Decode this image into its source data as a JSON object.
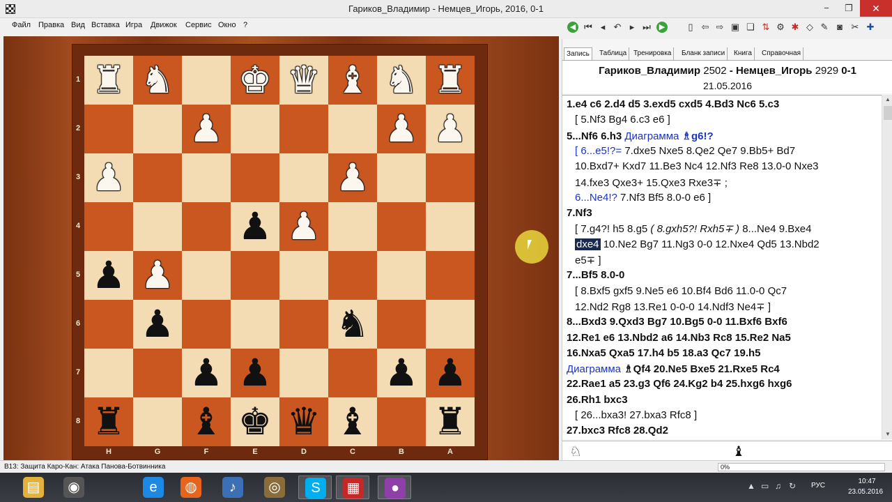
{
  "window": {
    "title": "Гариков_Владимир - Немцев_Игорь,  2016, 0-1",
    "min_glyph": "−",
    "max_glyph": "❐",
    "close_glyph": "✕"
  },
  "menu": [
    "Файл",
    "Правка",
    "Вид",
    "Вставка",
    "Игра",
    "Движок",
    "Сервис",
    "Окно",
    "?"
  ],
  "toolbar_icons": [
    "green-back-icon",
    "first-move-icon",
    "prev-move-icon",
    "undo-icon",
    "next-move-icon",
    "last-move-icon",
    "green-forward-icon",
    "new-doc-icon",
    "arrow-left-icon",
    "arrow-right-icon",
    "save-icon",
    "copy-icon",
    "flip-icon",
    "settings-icon",
    "engine-icon",
    "eraser-icon",
    "pen-icon",
    "camera-icon",
    "tools-icon",
    "plus-icon"
  ],
  "tabs": [
    "Запись",
    "Таблица",
    "Тренировка",
    "Бланк записи",
    "Книга",
    "Справочная"
  ],
  "header": {
    "white": "Гариков_Владимир",
    "white_elo": "2502",
    "black": "Немцев_Игорь",
    "black_elo": "2929",
    "result": "0-1",
    "date": "21.05.2016"
  },
  "board": {
    "pieces": [
      [
        "♜",
        "♞",
        "",
        "♚",
        "♛",
        "♝",
        "♞",
        "♜"
      ],
      [
        "",
        "",
        "♟",
        "",
        "",
        "",
        "♟",
        "♟"
      ],
      [
        "♟",
        "",
        "",
        "",
        "",
        "♟",
        "",
        ""
      ],
      [
        "",
        "",
        "",
        "♟",
        "♟",
        "",
        "",
        ""
      ],
      [
        "♟",
        "♟",
        "",
        "",
        "",
        "",
        "",
        ""
      ],
      [
        "",
        "♟",
        "",
        "",
        "",
        "♞",
        "",
        ""
      ],
      [
        "",
        "",
        "♟",
        "♟",
        "",
        "",
        "♟",
        "♟"
      ],
      [
        "♜",
        "",
        "♝",
        "♚",
        "♛",
        "♝",
        "",
        "♜"
      ]
    ],
    "colors": [
      [
        "w",
        "w",
        "",
        "w",
        "w",
        "w",
        "w",
        "w"
      ],
      [
        "",
        "",
        "w",
        "",
        "",
        "",
        "w",
        "w"
      ],
      [
        "w",
        "",
        "",
        "",
        "",
        "w",
        "",
        ""
      ],
      [
        "",
        "",
        "",
        "b",
        "w",
        "",
        "",
        ""
      ],
      [
        "b",
        "w",
        "",
        "",
        "",
        "",
        "",
        ""
      ],
      [
        "",
        "b",
        "",
        "",
        "",
        "b",
        "",
        ""
      ],
      [
        "",
        "",
        "b",
        "b",
        "",
        "",
        "b",
        "b"
      ],
      [
        "b",
        "",
        "b",
        "b",
        "b",
        "b",
        "",
        "b"
      ]
    ],
    "ranks": [
      "1",
      "2",
      "3",
      "4",
      "5",
      "6",
      "7",
      "8"
    ],
    "files": [
      "H",
      "G",
      "F",
      "E",
      "D",
      "C",
      "B",
      "A"
    ]
  },
  "notation": [
    {
      "type": "main",
      "segments": [
        {
          "t": "1.e4  c6  2.d4  d5  3.exd5  cxd5  4.Bd3  Nc6  5.c3"
        }
      ]
    },
    {
      "type": "var",
      "segments": [
        {
          "t": "[ 5.Nf3  Bg4  6.c3  e6 ]"
        }
      ]
    },
    {
      "type": "main",
      "segments": [
        {
          "t": "5...Nf6  6.h3 "
        },
        {
          "t": "Диаграмма ",
          "c": "blue",
          "w": "normal"
        },
        {
          "t": "♗g6!?",
          "c": "blue"
        }
      ]
    },
    {
      "type": "var",
      "segments": [
        {
          "t": "[ 6...e5!?= ",
          "c": "blue"
        },
        {
          "t": " 7.dxe5  Nxe5  8.Qe2  Qe7  9.Bb5+  Bd7"
        }
      ]
    },
    {
      "type": "var",
      "segments": [
        {
          "t": "10.Bxd7+  Kxd7  11.Be3  Nc4  12.Nf3  Re8  13.0-0  Nxe3"
        }
      ]
    },
    {
      "type": "var",
      "segments": [
        {
          "t": "14.fxe3  Qxe3+  15.Qxe3  Rxe3∓ ;"
        }
      ]
    },
    {
      "type": "var",
      "segments": [
        {
          "t": "6...Ne4!? ",
          "c": "blue"
        },
        {
          "t": " 7.Nf3  Bf5  8.0-0  e6 ]"
        }
      ]
    },
    {
      "type": "main",
      "segments": [
        {
          "t": "7.Nf3"
        }
      ]
    },
    {
      "type": "var",
      "segments": [
        {
          "t": "[ 7.g4?!  h5  8.g5  "
        },
        {
          "t": "( 8.gxh5?!  Rxh5∓ )",
          "i": true
        },
        {
          "t": "  8...Ne4  9.Bxe4"
        }
      ]
    },
    {
      "type": "var",
      "segments": [
        {
          "t": "dxe4",
          "hl": true
        },
        {
          "t": "  10.Ne2  Bg7  11.Ng3  0-0  12.Nxe4  Qd5  13.Nbd2"
        }
      ]
    },
    {
      "type": "var",
      "segments": [
        {
          "t": "e5∓ ]"
        }
      ]
    },
    {
      "type": "main",
      "segments": [
        {
          "t": "7...Bf5  8.0-0"
        }
      ]
    },
    {
      "type": "var",
      "segments": [
        {
          "t": "[ 8.Bxf5  gxf5  9.Ne5  e6  10.Bf4  Bd6  11.0-0  Qc7"
        }
      ]
    },
    {
      "type": "var",
      "segments": [
        {
          "t": "12.Nd2  Rg8  13.Re1  0-0-0  14.Ndf3  Ne4∓ ]"
        }
      ]
    },
    {
      "type": "main",
      "segments": [
        {
          "t": "8...Bxd3  9.Qxd3  Bg7  10.Bg5  0-0  11.Bxf6  Bxf6"
        }
      ]
    },
    {
      "type": "main",
      "segments": [
        {
          "t": "12.Re1  e6  13.Nbd2  a6  14.Nb3  Rc8  15.Re2  Na5"
        }
      ]
    },
    {
      "type": "main",
      "segments": [
        {
          "t": "16.Nxa5  Qxa5  17.h4  b5  18.a3  Qc7  19.h5"
        }
      ]
    },
    {
      "type": "main",
      "segments": [
        {
          "t": "Диаграмма ",
          "c": "blue",
          "w": "normal"
        },
        {
          "t": "♗Qf4  20.Ne5  Bxe5  21.Rxe5  Rc4"
        }
      ]
    },
    {
      "type": "main",
      "segments": [
        {
          "t": "22.Rae1  a5  23.g3  Qf6  24.Kg2  b4  25.hxg6  hxg6"
        }
      ]
    },
    {
      "type": "main",
      "segments": [
        {
          "t": "26.Rh1  bxc3"
        }
      ]
    },
    {
      "type": "var",
      "segments": [
        {
          "t": "[ 26...bxa3!  27.bxa3  Rfc8 ]"
        }
      ]
    },
    {
      "type": "main",
      "segments": [
        {
          "t": "27.bxc3  Rfc8  28.Qd2"
        }
      ]
    }
  ],
  "status": {
    "opening": "B13: Защита Каро-Кан: Атака Панова-Ботвинника",
    "progress": "0%",
    "progress_value": 0
  },
  "taskbar": {
    "apps": [
      "explorer-icon",
      "media-icon",
      "ie-icon",
      "firefox-icon",
      "sound-icon",
      "app-icon",
      "skype-icon",
      "chess-icon",
      "recorder-icon"
    ],
    "lang": "РУС",
    "time": "10:47",
    "date": "23.05.2016"
  }
}
